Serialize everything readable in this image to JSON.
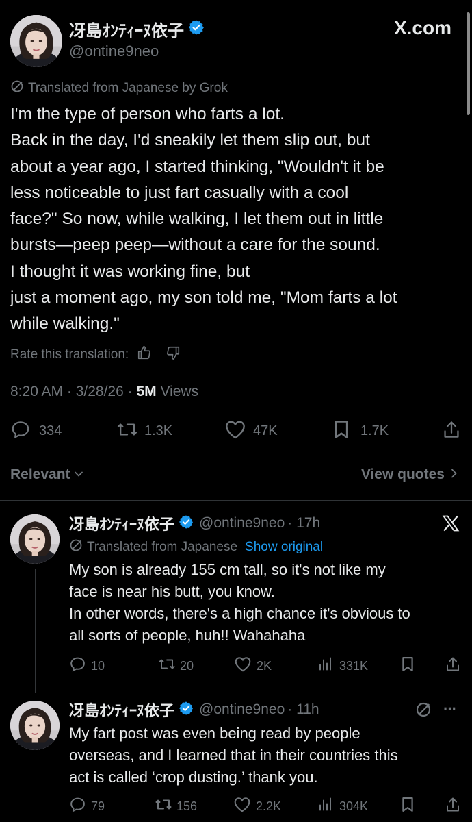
{
  "main_post": {
    "display_name": "冴島ｵﾝﾃｨｰﾇ依子",
    "handle": "@ontine9neo",
    "brand": "X.com",
    "translation_note": "Translated from Japanese by Grok",
    "body_lines": [
      "I'm the type of person who farts a lot.",
      "Back in the day, I'd sneakily let them slip out, but",
      "about a year ago, I started thinking, \"Wouldn't it be",
      "less noticeable to just fart casually with a cool",
      "face?\" So now, while walking, I let them out in little",
      "bursts—peep peep—without a care for the sound.",
      "I thought it was working fine, but",
      "just a moment ago, my son told me, \"Mom farts a lot",
      "while walking.\""
    ],
    "rate_label": "Rate this translation:",
    "timestamp": "8:20 AM · 3/28/26 · ",
    "views_count": "5M",
    "views_label": " Views",
    "replies": "334",
    "reposts": "1.3K",
    "likes": "47K",
    "bookmarks": "1.7K"
  },
  "filter_bar": {
    "sort_label": "Relevant",
    "quotes_label": "View quotes"
  },
  "replies": [
    {
      "display_name": "冴島ｵﾝﾃｨｰﾇ依子",
      "handle": "@ontine9neo",
      "time": "· 17h",
      "translation_note": "Translated from Japanese",
      "show_original": "Show original",
      "body_lines": [
        "My son is already 155 cm tall, so it's not like my",
        "face is near his butt, you know.",
        "In other words, there's a high chance it's obvious to",
        "all sorts of people, huh!! Wahahaha"
      ],
      "replies": "10",
      "reposts": "20",
      "likes": "2K",
      "views": "331K"
    },
    {
      "display_name": "冴島ｵﾝﾃｨｰﾇ依子",
      "handle": "@ontine9neo",
      "time": "· 11h",
      "more": "···",
      "body_lines": [
        "My fart post was even being read by people",
        "overseas, and I learned that in their countries this",
        "act is called ‘crop dusting.’ thank you."
      ],
      "replies": "79",
      "reposts": "156",
      "likes": "2.2K",
      "views": "304K"
    }
  ],
  "colors": {
    "background": "#000000",
    "text": "#e7e9ea",
    "muted": "#71767b",
    "verified": "#1d9bf0",
    "link": "#1d9bf0",
    "divider": "#2f3336"
  }
}
